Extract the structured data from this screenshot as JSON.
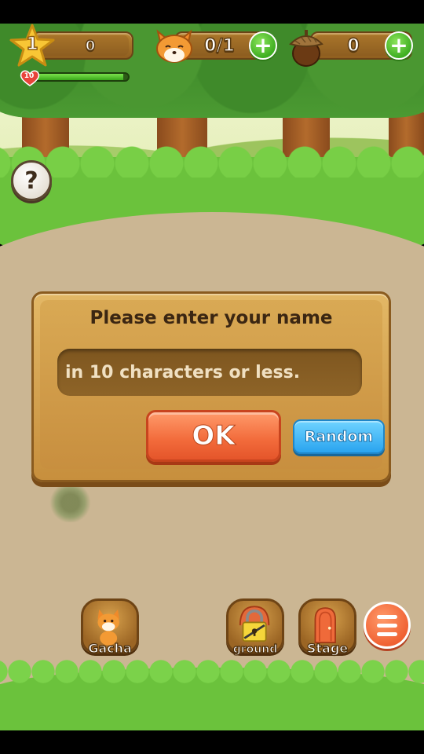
{
  "hud": {
    "level": "1",
    "level_score": "0",
    "exp_progress": 0.95,
    "hearts": "10",
    "foxes": "0/1",
    "acorns": "0"
  },
  "help": {
    "label": "?"
  },
  "dialog": {
    "title": "Please enter your name",
    "input_placeholder": "in 10 characters or less.",
    "input_value": "",
    "ok_label": "OK",
    "random_label": "Random"
  },
  "toolbar": {
    "gacha_label": "Gacha",
    "ground_label": "ground",
    "stage_label": "Stage"
  },
  "colors": {
    "grass": "#6bc23c",
    "dirt": "#cbb693",
    "ok_button": "#f26a3a",
    "random_button": "#2aa4ef",
    "panel": "#d9a954"
  },
  "icons": [
    "star-icon",
    "fox-icon",
    "acorn-icon",
    "plus-icon",
    "heart-icon",
    "question-icon",
    "lock-icon",
    "door-icon",
    "menu-icon"
  ]
}
